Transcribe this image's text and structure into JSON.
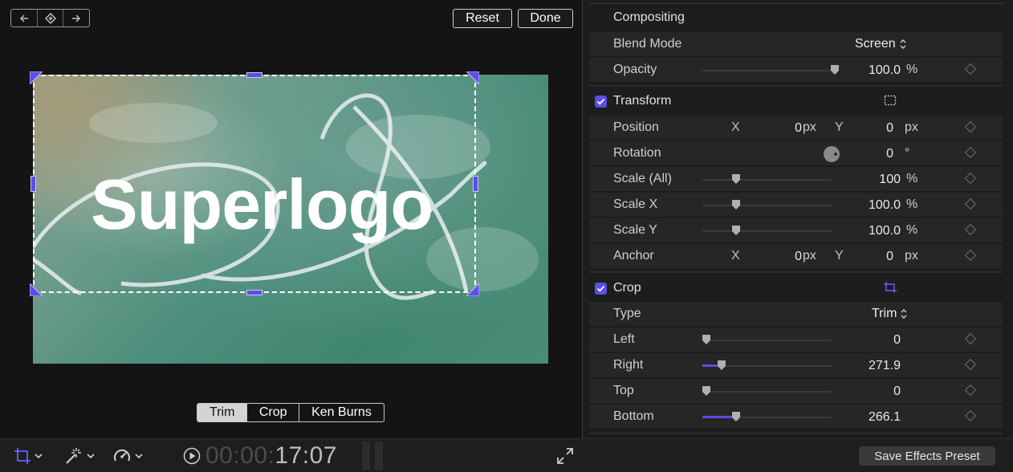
{
  "toolbar": {
    "keyframe_icons": [
      "arrow-left-icon",
      "keyframe-diamond-icon",
      "arrow-right-icon"
    ],
    "reset_label": "Reset",
    "done_label": "Done"
  },
  "viewer": {
    "logo_text": "Superlogo",
    "crop_modes": [
      {
        "label": "Trim",
        "selected": true
      },
      {
        "label": "Crop",
        "selected": false
      },
      {
        "label": "Ken Burns",
        "selected": false
      }
    ]
  },
  "bottombar": {
    "tools": [
      "crop-tool-icon",
      "enhance-wand-icon",
      "speed-retime-icon"
    ],
    "timecode_dim": "00:00:",
    "timecode_bright": "17:07"
  },
  "inspector": {
    "compositing": {
      "title": "Compositing",
      "blend_mode_label": "Blend Mode",
      "blend_mode_value": "Screen",
      "opacity_label": "Opacity",
      "opacity_value": "100.0",
      "opacity_unit": "%",
      "opacity_fraction": 1.0
    },
    "transform": {
      "title": "Transform",
      "enabled": true,
      "position_label": "Position",
      "position_x_axis": "X",
      "position_x_value": "0",
      "position_x_unit": "px",
      "position_y_axis": "Y",
      "position_y_value": "0",
      "position_y_unit": "px",
      "rotation_label": "Rotation",
      "rotation_value": "0",
      "rotation_unit": "°",
      "scale_all_label": "Scale (All)",
      "scale_all_value": "100",
      "scale_all_unit": "%",
      "scale_x_label": "Scale X",
      "scale_x_value": "100.0",
      "scale_x_unit": "%",
      "scale_y_label": "Scale Y",
      "scale_y_value": "100.0",
      "scale_y_unit": "%",
      "anchor_label": "Anchor",
      "anchor_x_axis": "X",
      "anchor_x_value": "0",
      "anchor_x_unit": "px",
      "anchor_y_axis": "Y",
      "anchor_y_value": "0",
      "anchor_y_unit": "px"
    },
    "crop": {
      "title": "Crop",
      "enabled": true,
      "type_label": "Type",
      "type_value": "Trim",
      "left_label": "Left",
      "left_value": "0",
      "right_label": "Right",
      "right_value": "271.9",
      "top_label": "Top",
      "top_value": "0",
      "bottom_label": "Bottom",
      "bottom_value": "266.1"
    },
    "save_preset_label": "Save Effects Preset"
  },
  "colors": {
    "accent": "#5a4ee6",
    "panel_bg": "#1d1d1d",
    "row_bg": "#262626"
  }
}
